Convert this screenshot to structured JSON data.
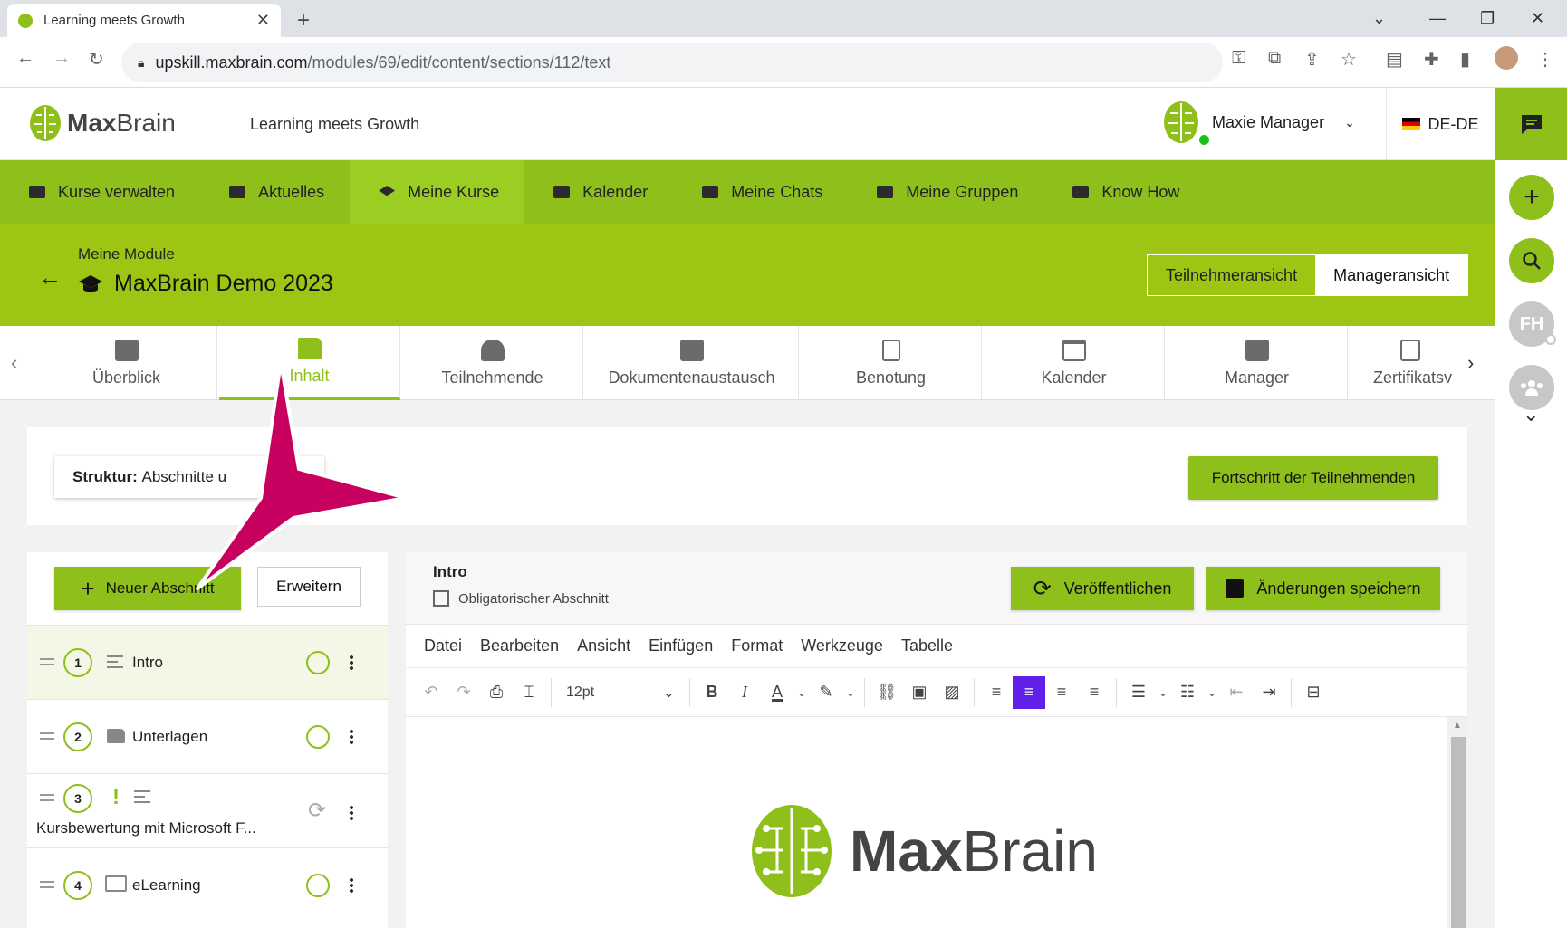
{
  "browser": {
    "tab_title": "Learning meets Growth",
    "url_host": "upskill.maxbrain.com",
    "url_path": "/modules/69/edit/content/sections/112/text"
  },
  "header": {
    "logo_bold": "Max",
    "logo_light": "Brain",
    "tagline": "Learning meets Growth",
    "user_name": "Maxie Manager",
    "language": "DE-DE"
  },
  "rail": {
    "avatar_initials": "FH"
  },
  "main_nav": [
    {
      "label": "Kurse verwalten"
    },
    {
      "label": "Aktuelles"
    },
    {
      "label": "Meine Kurse"
    },
    {
      "label": "Kalender"
    },
    {
      "label": "Meine Chats"
    },
    {
      "label": "Meine Gruppen"
    },
    {
      "label": "Know How"
    }
  ],
  "module": {
    "breadcrumb": "Meine Module",
    "title": "MaxBrain Demo 2023",
    "view_participant": "Teilnehmeransicht",
    "view_manager": "Manageransicht"
  },
  "sub_tabs": [
    {
      "label": "Überblick"
    },
    {
      "label": "Inhalt"
    },
    {
      "label": "Teilnehmende"
    },
    {
      "label": "Dokumentenaustausch"
    },
    {
      "label": "Benotung"
    },
    {
      "label": "Kalender"
    },
    {
      "label": "Manager"
    },
    {
      "label": "Zertifikatsv"
    }
  ],
  "structure": {
    "label": "Struktur:",
    "value": "Abschnitte u",
    "progress_button": "Fortschritt der Teilnehmenden"
  },
  "sections_panel": {
    "new_section": "Neuer Abschnitt",
    "expand": "Erweitern",
    "rows": [
      {
        "num": "1",
        "title": "Intro"
      },
      {
        "num": "2",
        "title": "Unterlagen"
      },
      {
        "num": "3",
        "title": "Kursbewertung mit Microsoft F..."
      },
      {
        "num": "4",
        "title": "eLearning"
      }
    ],
    "warning_mark": "!"
  },
  "editor": {
    "section_title": "Intro",
    "mandatory_label": "Obligatorischer Abschnitt",
    "publish": "Veröffentlichen",
    "save": "Änderungen speichern",
    "menu": [
      "Datei",
      "Bearbeiten",
      "Ansicht",
      "Einfügen",
      "Format",
      "Werkzeuge",
      "Tabelle"
    ],
    "font_size": "12pt",
    "content_logo_bold": "Max",
    "content_logo_light": "Brain"
  },
  "colors": {
    "brand_green": "#8fbf1a",
    "module_header": "#9dc614",
    "annotation_arrow": "#c8005f",
    "toolbar_active": "#6020e8"
  }
}
